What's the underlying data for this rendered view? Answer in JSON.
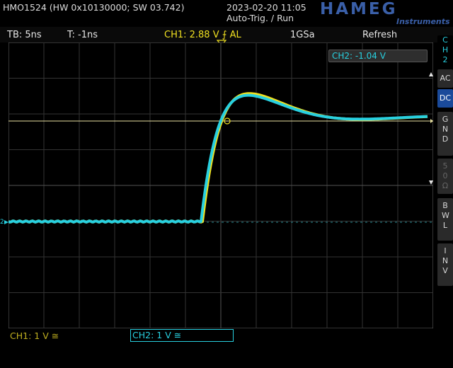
{
  "header": {
    "device": "HMO1524 (HW 0x10130000; SW 03.742)",
    "datetime": "2023-02-20 11:05",
    "trigger_mode": "Auto-Trig. / Run",
    "brand": "HAMEG",
    "brand_sub": "Instruments"
  },
  "infobar": {
    "timebase": "TB: 5ns",
    "trigger_time": "T: -1ns",
    "ch1_trigger": "CH1: 2.88 V ⨍ AL",
    "sample_rate": "1GSa",
    "refresh": "Refresh"
  },
  "readout": {
    "ch2": "CH2: -1.04 V"
  },
  "sidebar": {
    "channel": "CH2",
    "items": [
      {
        "label": "AC"
      },
      {
        "label": "DC"
      },
      {
        "label": "GND"
      },
      {
        "label": "50Ω"
      },
      {
        "label": "BWL"
      },
      {
        "label": "INV"
      }
    ]
  },
  "footer": {
    "ch1": "CH1: 1 V ≅",
    "ch2": "CH2: 1 V ≅"
  },
  "colors": {
    "ch1": "#f0e020",
    "ch2": "#28d0e0",
    "grid": "#3a3a3a",
    "brand": "#3a5fa8"
  }
}
